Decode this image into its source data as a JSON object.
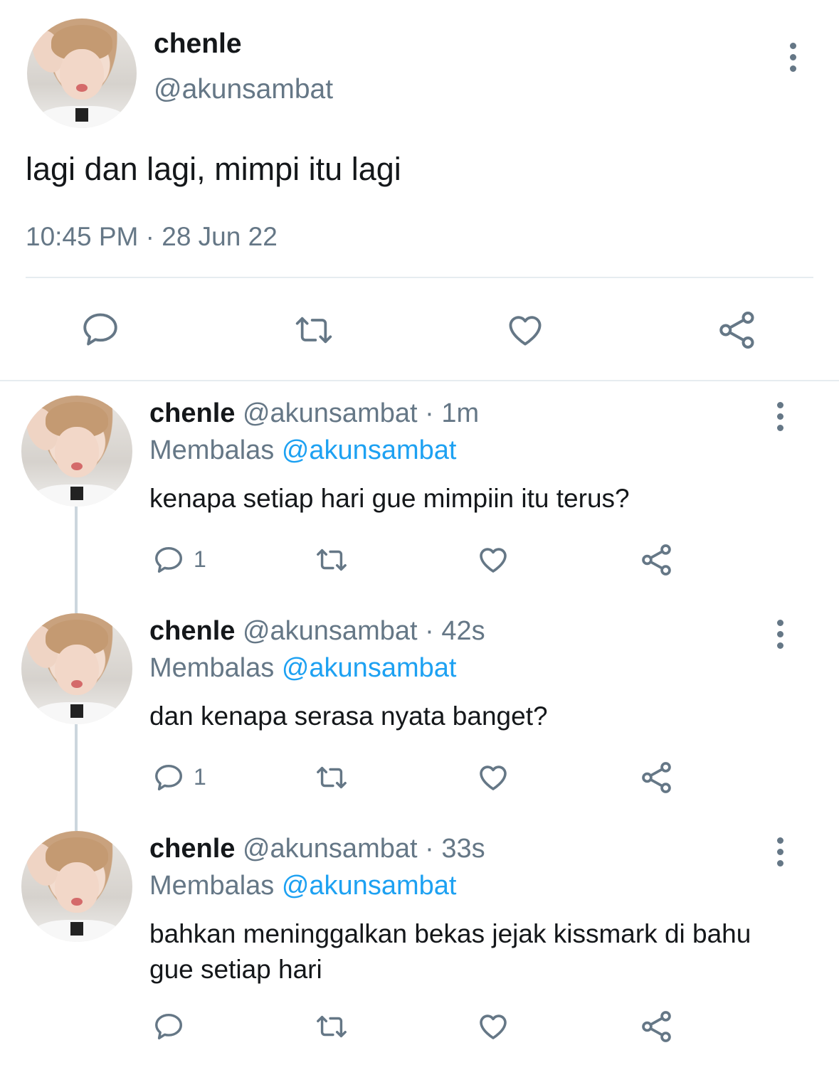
{
  "main_tweet": {
    "name": "chenle",
    "handle": "@akunsambat",
    "text": "lagi dan lagi, mimpi itu lagi",
    "timestamp": "10:45 PM · 28 Jun 22",
    "avatar_icon": "profile-photo",
    "actions": [
      "reply-icon",
      "retweet-icon",
      "like-icon",
      "share-icon"
    ]
  },
  "replies": [
    {
      "name": "chenle",
      "meta": "@akunsambat · 1m",
      "reply_prefix": "Membalas ",
      "reply_to": "@akunsambat",
      "text": "kenapa setiap hari gue mimpiin itu terus?",
      "reply_count": "1"
    },
    {
      "name": "chenle",
      "meta": "@akunsambat · 42s",
      "reply_prefix": "Membalas ",
      "reply_to": "@akunsambat",
      "text": "dan kenapa serasa nyata banget?",
      "reply_count": "1"
    },
    {
      "name": "chenle",
      "meta": "@akunsambat · 33s",
      "reply_prefix": "Membalas ",
      "reply_to": "@akunsambat",
      "text": "bahkan meninggalkan bekas jejak kissmark di bahu gue setiap hari",
      "reply_count": ""
    }
  ],
  "colors": {
    "text": "#14171a",
    "secondary": "#657786",
    "link": "#1da1f2",
    "divider": "#e6ecf0",
    "thread_line": "#ccd6dd"
  }
}
